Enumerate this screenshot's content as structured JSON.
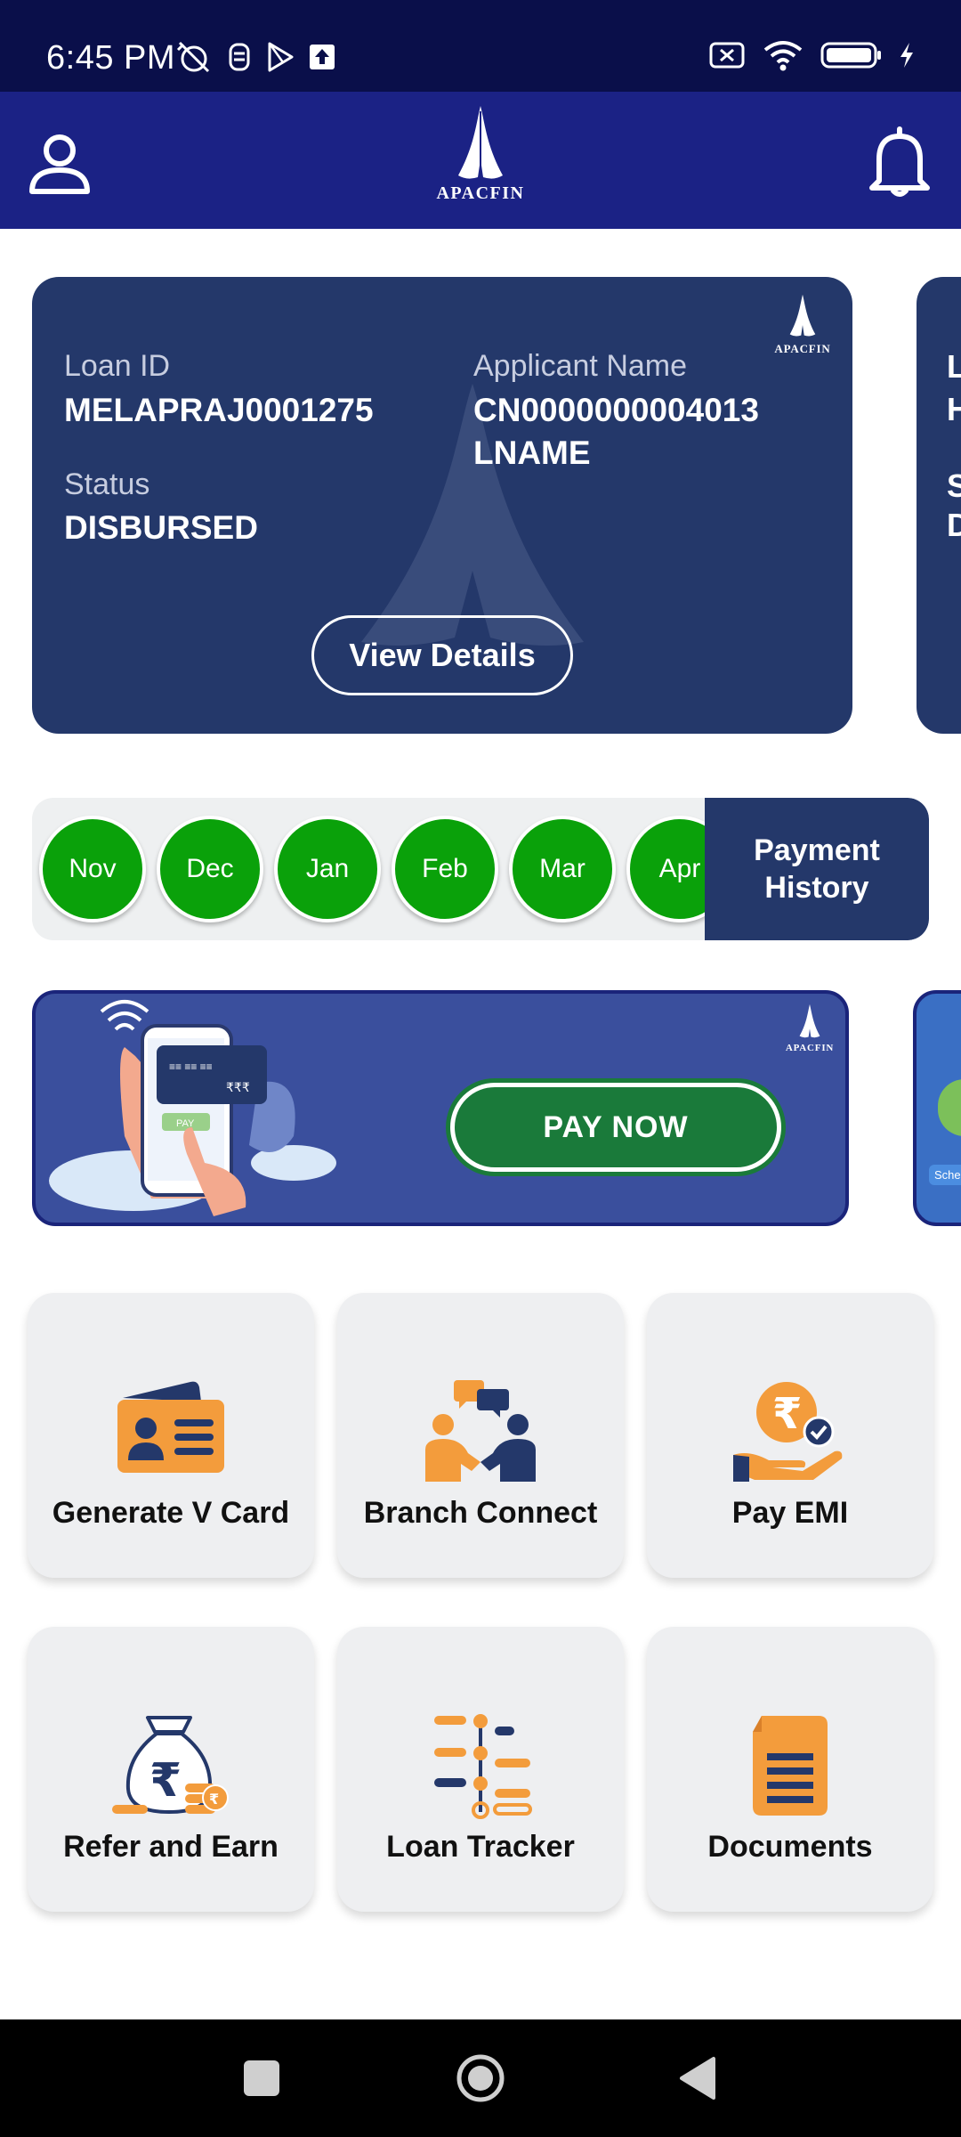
{
  "status_bar": {
    "time": "6:45 PM",
    "left_icons": [
      "muted-alarm-icon",
      "tag-icon",
      "play-store-icon",
      "upload-icon"
    ],
    "right_icons": [
      "no-sim-icon",
      "wifi-icon",
      "battery-icon",
      "charging-icon"
    ]
  },
  "header": {
    "brand": "APACFIN",
    "left_icon": "profile-icon",
    "right_icon": "bell-icon"
  },
  "loan_card": {
    "loan_id_label": "Loan ID",
    "loan_id": "MELAPRAJ0001275",
    "applicant_label": "Applicant Name",
    "applicant_line1": "CN0000000004013",
    "applicant_line2": "LNAME",
    "status_label": "Status",
    "status": "DISBURSED",
    "view_details": "View Details",
    "brand": "APACFIN"
  },
  "peek_card": {
    "letters": [
      "L",
      "H",
      "S",
      "D"
    ]
  },
  "payments": {
    "months": [
      "Nov",
      "Dec",
      "Jan",
      "Feb",
      "Mar",
      "Apr"
    ],
    "status_color": "#0aa10a",
    "history_line1": "Payment",
    "history_line2": "History"
  },
  "banner": {
    "pay_now": "PAY NOW",
    "brand": "APACFIN",
    "card_text": "₹₹₹",
    "phone_button": "PAY",
    "peek_text": "Sche"
  },
  "tiles": [
    {
      "label": "Generate V Card",
      "icon": "id-card-icon"
    },
    {
      "label": "Branch Connect",
      "icon": "chat-people-icon"
    },
    {
      "label": "Pay EMI",
      "icon": "rupee-hand-icon"
    },
    {
      "label": "Refer and Earn",
      "icon": "money-bag-icon"
    },
    {
      "label": "Loan Tracker",
      "icon": "tracker-icon"
    },
    {
      "label": "Documents",
      "icon": "document-icon"
    }
  ],
  "colors": {
    "header_bg": "#1b2285",
    "card_bg": "#24386a",
    "accent_orange": "#f39c3c",
    "paid_green": "#0aa10a"
  }
}
